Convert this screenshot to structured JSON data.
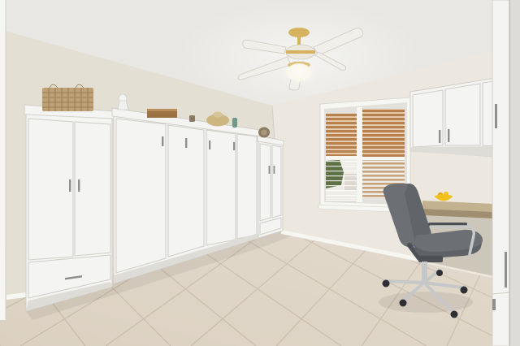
{
  "colors": {
    "ceiling": "#e8e7e3",
    "wall_left": "#e4dfd3",
    "wall_back": "#ece8df",
    "trim": "#f6f6f3",
    "trim_shade": "#e2e1dc",
    "floor": "#dcd1c1",
    "grout": "#c8bba8",
    "cabinet": "#f4f4f2",
    "cabinet_shade": "#dedcd7",
    "cabinet_line": "#cfcdc7",
    "handle": "#8f8f8f",
    "basket": "#bfa074",
    "basket_dark": "#8f734c",
    "wood": "#9c7444",
    "slat": "#b8804c",
    "slat_gap": "#e7d2b8",
    "slat_light": "#c7a27a",
    "outdoor": "#eeede7",
    "foliage": "#5f7147",
    "countertop": "#c3b28f",
    "countertop_edge": "#9f8e70",
    "under_desk": "#cdc7ba",
    "bowl": "#f1c11e",
    "chair": "#6c6f73",
    "chair_dark": "#4d5054",
    "chrome": "#c6c7c9",
    "caster": "#2f3033",
    "fan_blade": "#f1efe9",
    "fan_trim": "#d4b25e",
    "globe": "#f8f4e6"
  }
}
